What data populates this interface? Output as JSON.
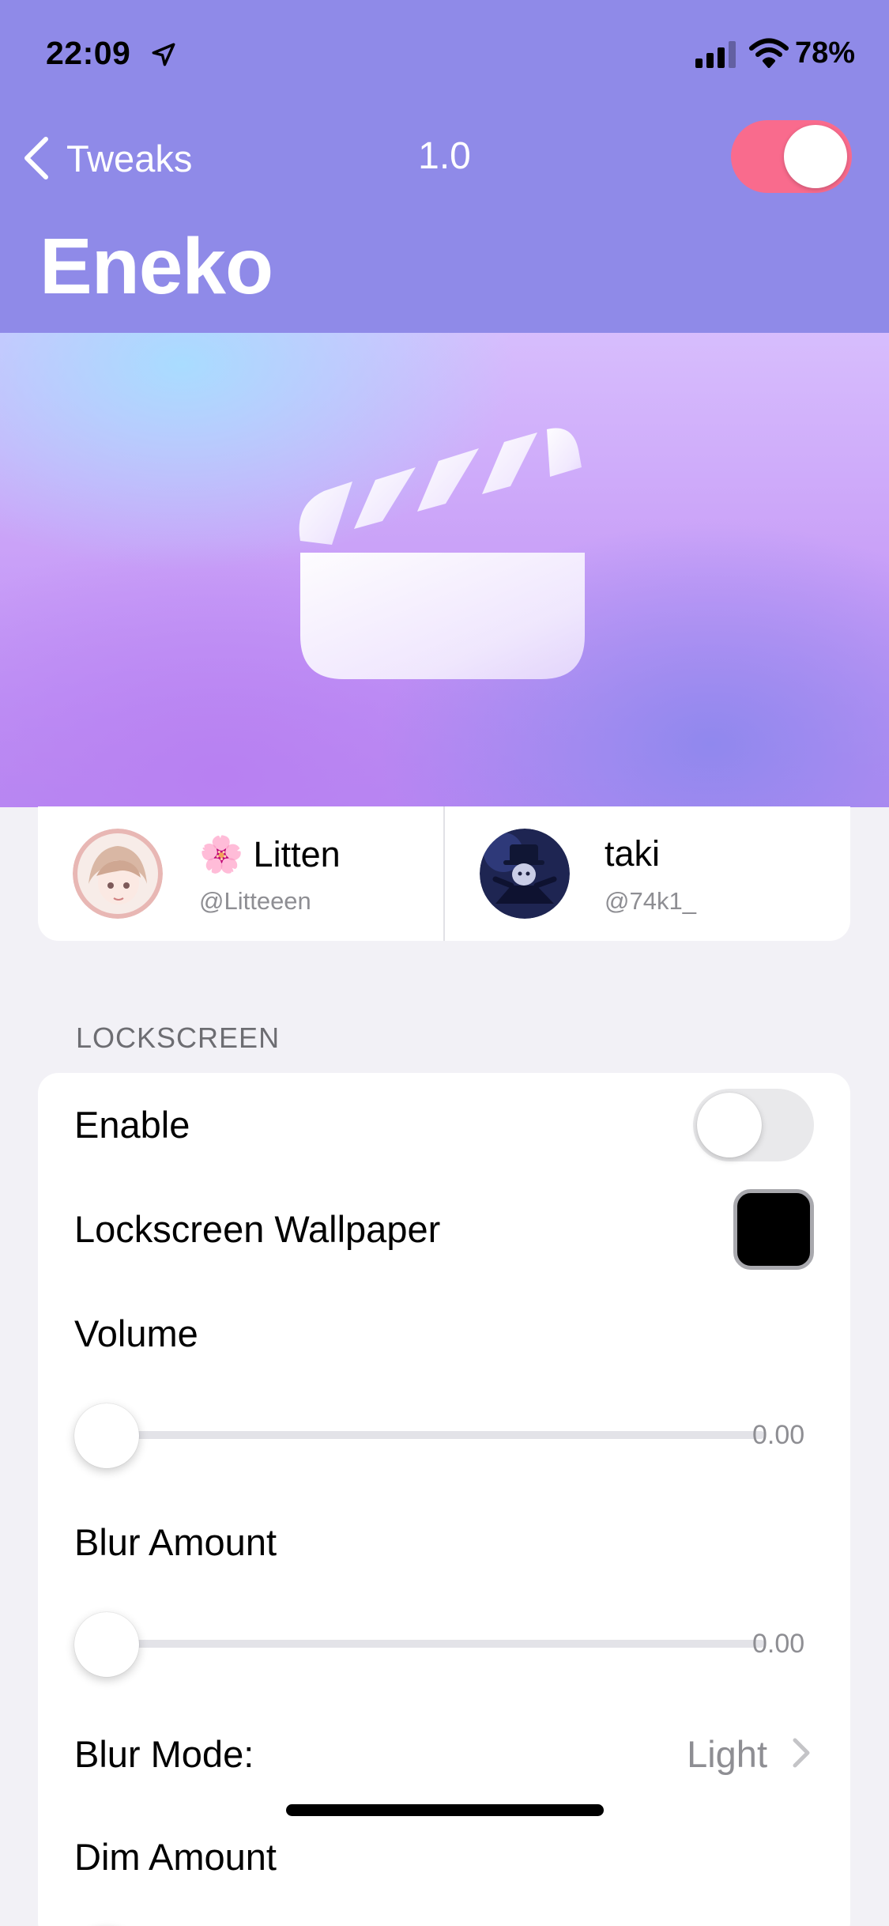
{
  "status_bar": {
    "time": "22:09",
    "battery": "78%",
    "icons": [
      "location-arrow-icon",
      "cellular-signal-icon",
      "wifi-icon"
    ]
  },
  "nav": {
    "back_label": "Tweaks",
    "version": "1.0",
    "enabled": true,
    "title": "Eneko"
  },
  "banner": {
    "icon": "clapperboard-icon"
  },
  "credits": [
    {
      "emoji": "🌸",
      "name": "Litten",
      "handle": "@Litteeen"
    },
    {
      "name": "taki",
      "handle": "@74k1_"
    }
  ],
  "section": {
    "header": "LOCKSCREEN",
    "rows": {
      "enable": {
        "label": "Enable",
        "value": false
      },
      "wallpaper": {
        "label": "Lockscreen Wallpaper",
        "color": "#000000"
      },
      "volume": {
        "label": "Volume",
        "value": "0.00",
        "fraction": 0
      },
      "blur_amount": {
        "label": "Blur Amount",
        "value": "0.00",
        "fraction": 0
      },
      "blur_mode": {
        "label": "Blur Mode:",
        "value": "Light"
      },
      "dim_amount": {
        "label": "Dim Amount"
      }
    }
  },
  "colors": {
    "header": "#8f8ae8",
    "toggle_on": "#f96b8d",
    "background": "#f2f1f6"
  }
}
